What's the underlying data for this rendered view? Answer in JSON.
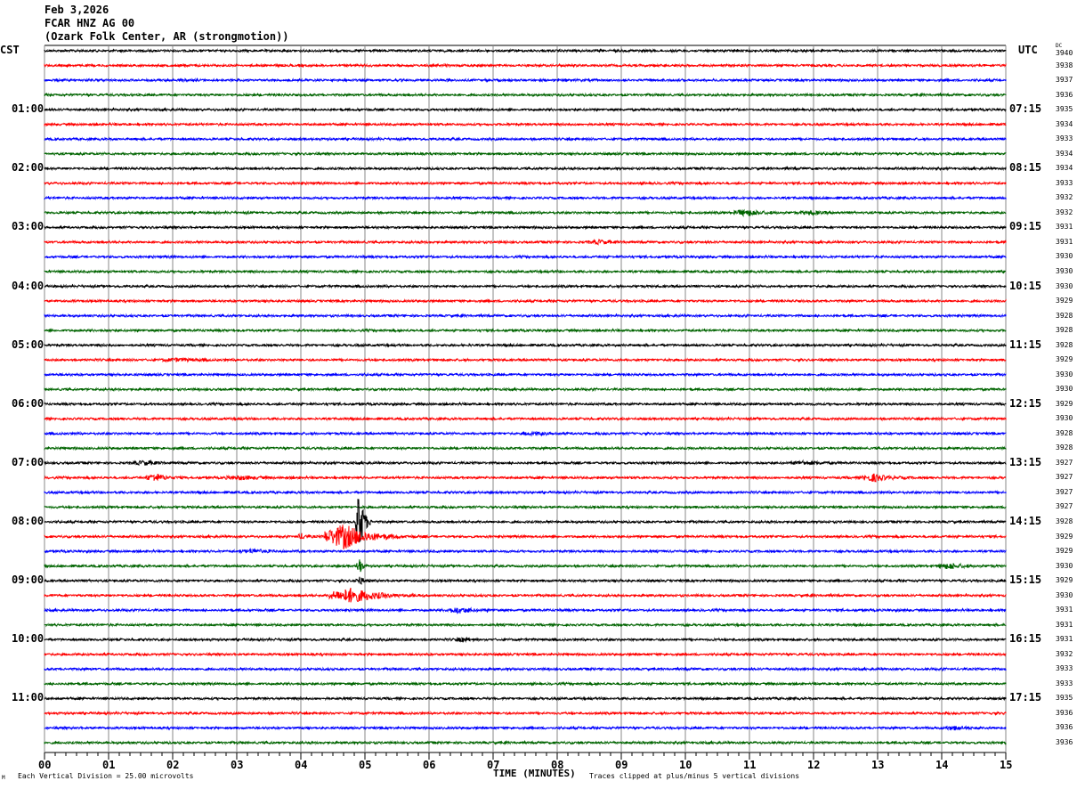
{
  "header": {
    "date": "Feb 3,2026",
    "station": "FCAR HNZ AG 00",
    "location": "(Ozark Folk Center, AR (strongmotion))"
  },
  "left_zone": "CST",
  "right_zone": "UTC",
  "dc_label": "DC",
  "footer": {
    "logo_mark": "M",
    "scale_note": "Each Vertical Division =   25.00 microvolts",
    "clip_note": "Traces clipped at plus/minus 5 vertical divisions"
  },
  "chart_data": {
    "type": "line",
    "title": "FCAR HNZ AG 00 helicorder, Feb 3,2026",
    "xlabel": "TIME (MINUTES)",
    "xlim": [
      0,
      15
    ],
    "x_ticks": [
      "00",
      "01",
      "02",
      "03",
      "04",
      "05",
      "06",
      "07",
      "08",
      "09",
      "10",
      "11",
      "12",
      "13",
      "14",
      "15"
    ],
    "rows_per_hour": 4,
    "row_minutes": 15,
    "trace_colors": [
      "#000000",
      "#ff0000",
      "#0000ff",
      "#006400"
    ],
    "left_hour_labels": [
      "01:00",
      "02:00",
      "03:00",
      "04:00",
      "05:00",
      "06:00",
      "07:00",
      "08:00",
      "09:00",
      "10:00",
      "11:00"
    ],
    "right_hour_labels": [
      "07:15",
      "08:15",
      "09:15",
      "10:15",
      "11:15",
      "12:15",
      "13:15",
      "14:15",
      "15:15",
      "16:15",
      "17:15"
    ],
    "dc_offsets": [
      3940,
      3938,
      3937,
      3936,
      3935,
      3934,
      3933,
      3934,
      3934,
      3933,
      3932,
      3932,
      3931,
      3931,
      3930,
      3930,
      3930,
      3929,
      3928,
      3928,
      3928,
      3929,
      3930,
      3930,
      3929,
      3930,
      3928,
      3928,
      3927,
      3927,
      3927,
      3927,
      3928,
      3929,
      3929,
      3930,
      3929,
      3930,
      3931,
      3931,
      3931,
      3932,
      3933,
      3933,
      3935,
      3936,
      3936,
      3936
    ],
    "clip_divisions": 5,
    "events": [
      {
        "row": 11,
        "minute": 10.9,
        "amp": 3,
        "dur": 0.6
      },
      {
        "row": 11,
        "minute": 11.9,
        "amp": 2,
        "dur": 0.4
      },
      {
        "row": 13,
        "minute": 8.6,
        "amp": 2,
        "dur": 0.5
      },
      {
        "row": 21,
        "minute": 2.0,
        "amp": 1.5,
        "dur": 0.6
      },
      {
        "row": 26,
        "minute": 7.6,
        "amp": 1.5,
        "dur": 0.5
      },
      {
        "row": 28,
        "minute": 1.5,
        "amp": 2,
        "dur": 0.6
      },
      {
        "row": 28,
        "minute": 11.8,
        "amp": 2,
        "dur": 0.5
      },
      {
        "row": 29,
        "minute": 1.7,
        "amp": 4,
        "dur": 0.4
      },
      {
        "row": 29,
        "minute": 3.0,
        "amp": 2,
        "dur": 0.6
      },
      {
        "row": 29,
        "minute": 12.9,
        "amp": 4,
        "dur": 0.5
      },
      {
        "row": 32,
        "minute": 4.9,
        "amp": 40,
        "dur": 0.15
      },
      {
        "row": 33,
        "minute": 4.6,
        "amp": 14,
        "dur": 0.8
      },
      {
        "row": 33,
        "minute": 4.0,
        "amp": 3,
        "dur": 0.2
      },
      {
        "row": 34,
        "minute": 3.2,
        "amp": 2,
        "dur": 0.6
      },
      {
        "row": 35,
        "minute": 4.9,
        "amp": 12,
        "dur": 0.1
      },
      {
        "row": 35,
        "minute": 14.1,
        "amp": 3,
        "dur": 0.5
      },
      {
        "row": 36,
        "minute": 4.9,
        "amp": 4,
        "dur": 0.2
      },
      {
        "row": 37,
        "minute": 4.7,
        "amp": 8,
        "dur": 0.9
      },
      {
        "row": 38,
        "minute": 6.4,
        "amp": 3,
        "dur": 0.5
      },
      {
        "row": 40,
        "minute": 6.5,
        "amp": 2,
        "dur": 0.3
      },
      {
        "row": 46,
        "minute": 14.2,
        "amp": 2,
        "dur": 0.5
      }
    ]
  }
}
